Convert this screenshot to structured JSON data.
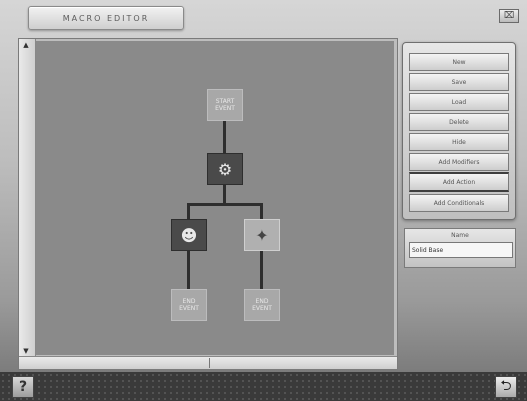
{
  "window": {
    "title": "MACRO EDITOR",
    "close_glyph": "⌧"
  },
  "canvas": {
    "scroll_up_glyph": "▲",
    "scroll_down_glyph": "▼",
    "nodes": {
      "start": "START\nEVENT",
      "end_left": "END\nEVENT",
      "end_right": "END\nEVENT",
      "root_icon": "robot-icon",
      "left_icon": "person-icon",
      "right_icon": "sparkle-icon",
      "root_glyph": "⚙",
      "left_glyph": "☻",
      "right_glyph": "✦"
    }
  },
  "actions": {
    "new": "New",
    "save": "Save",
    "load": "Load",
    "delete": "Delete",
    "hide": "Hide",
    "add_modifiers": "Add Modifiers",
    "add_action": "Add Action",
    "add_conditionals": "Add Conditionals"
  },
  "name_panel": {
    "label": "Name",
    "value": "Solid Base"
  },
  "footer": {
    "help_glyph": "?",
    "exit_glyph": "⮌"
  },
  "colors": {
    "canvas": "#8a8a8a",
    "node_line": "#2e2e2e",
    "bottom_bar": "#3a3a3a"
  }
}
